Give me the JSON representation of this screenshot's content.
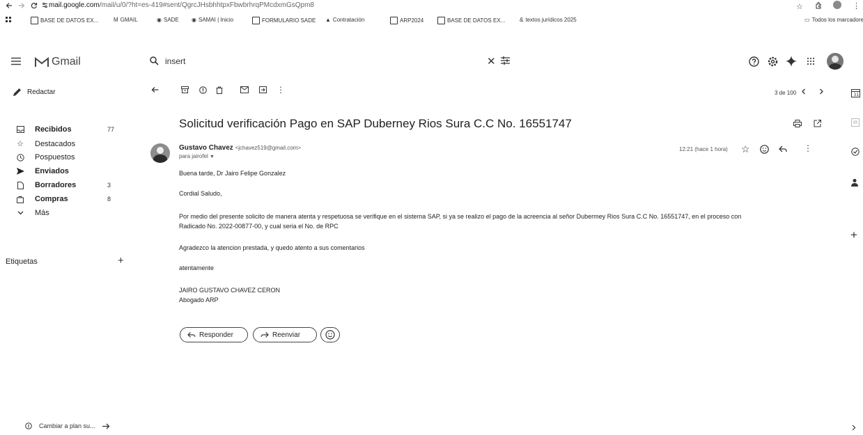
{
  "browser": {
    "url_domain": "mail.google.com",
    "url_path": "/mail/u/0/?ht=es-419#sent/QgrcJHsbhhtpxFbwbrhrqPMcdxmGsQpm8",
    "bookmarks": [
      "BASE DE DATOS EX...",
      "GMAIL",
      "SADE",
      "SAMAI | Inicio",
      "FORMULARIO SADE",
      "Contratación",
      "ARP2024",
      "BASE DE DATOS EX...",
      "textos jurídicos 2025"
    ],
    "all_bookmarks": "Todos los marcadores"
  },
  "app": {
    "name": "Gmail"
  },
  "search": {
    "query": "insert"
  },
  "sidebar": {
    "compose": "Redactar",
    "items": [
      {
        "label": "Recibidos",
        "count": "77",
        "bold": true
      },
      {
        "label": "Destacados",
        "count": "",
        "bold": false
      },
      {
        "label": "Pospuestos",
        "count": "",
        "bold": false
      },
      {
        "label": "Enviados",
        "count": "",
        "bold": true
      },
      {
        "label": "Borradores",
        "count": "3",
        "bold": true
      },
      {
        "label": "Compras",
        "count": "8",
        "bold": true
      },
      {
        "label": "Más",
        "count": "",
        "bold": false
      }
    ],
    "labels_title": "Etiquetas",
    "upgrade": "Cambiar a plan su..."
  },
  "toolbar": {
    "pagination": "3 de 100"
  },
  "email": {
    "subject": "Solicitud verificación Pago en SAP Duberney Rios Sura C.C No. 16551747",
    "sender_name": "Gustavo Chavez",
    "sender_email": "<jchavez519@gmail.com>",
    "to": "para jairofel",
    "time": "12:21 (hace 1 hora)",
    "body": [
      "Buena tarde, Dr Jairo Felipe Gonzalez",
      "Cordial Saludo,",
      "Por medio del presente solicito de manera atenta y respetuosa se verifique en el sistema SAP, si ya se realizo el pago de la acreencia al señor Dubermey Rios Sura  C.C No. 16551747, en el proceso con",
      "Radicado No.   2022-00877-00, y cual seria el No. de RPC",
      "Agradezco la atencion prestada, y quedo atento a sus comentarios",
      "atentamente",
      "JAIRO GUSTAVO CHAVEZ CERON",
      "Abogado ARP"
    ]
  },
  "actions": {
    "reply": "Responder",
    "forward": "Reenviar"
  },
  "colors": {
    "background": "#ffffff",
    "text": "#222222"
  }
}
